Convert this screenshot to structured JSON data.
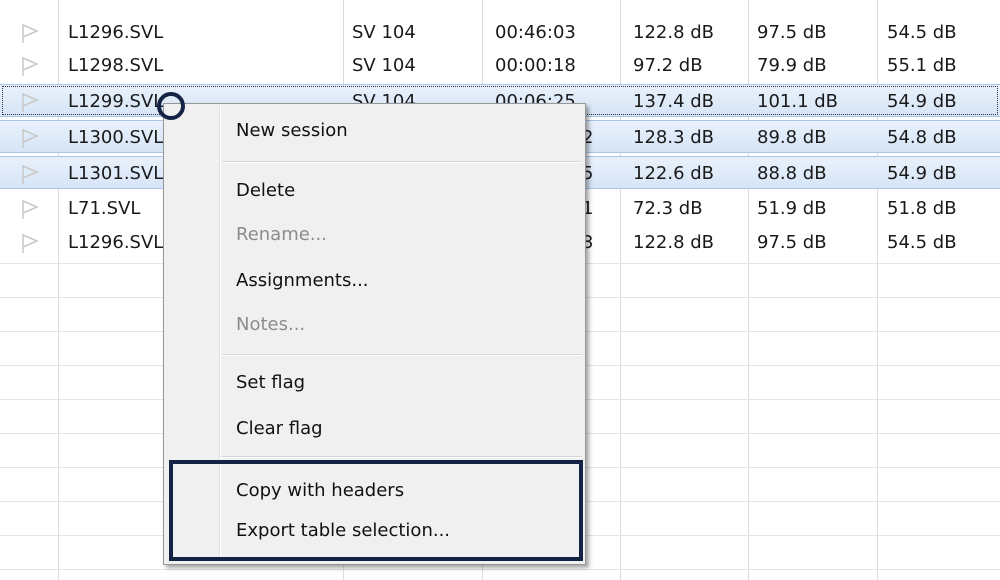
{
  "table": {
    "rows": [
      {
        "file": "L1296.SVL",
        "device": "SV 104",
        "duration": "00:46:03",
        "peak": "122.8 dB",
        "max": "97.5 dB",
        "min": "54.5 dB"
      },
      {
        "file": "L1298.SVL",
        "device": "SV 104",
        "duration": "00:00:18",
        "peak": "97.2 dB",
        "max": "79.9 dB",
        "min": "55.1 dB"
      },
      {
        "file": "L1299.SVL",
        "device": "SV 104",
        "duration": "00:06:25",
        "peak": "137.4 dB",
        "max": "101.1 dB",
        "min": "54.9 dB"
      },
      {
        "file": "L1300.SVL",
        "device": "",
        "duration": "2",
        "peak": "128.3 dB",
        "max": "89.8 dB",
        "min": "54.8 dB"
      },
      {
        "file": "L1301.SVL",
        "device": "",
        "duration": "5",
        "peak": "122.6 dB",
        "max": "88.8 dB",
        "min": "54.9 dB"
      },
      {
        "file": "L71.SVL",
        "device": "",
        "duration": "1",
        "peak": "72.3 dB",
        "max": "51.9 dB",
        "min": "51.8 dB"
      },
      {
        "file": "L1296.SVL",
        "device": "",
        "duration": "3",
        "peak": "122.8 dB",
        "max": "97.5 dB",
        "min": "54.5 dB"
      }
    ]
  },
  "context_menu": {
    "new_session": "New session",
    "delete": "Delete",
    "rename": "Rename...",
    "assignments": "Assignments...",
    "notes": "Notes...",
    "set_flag": "Set flag",
    "clear_flag": "Clear flag",
    "copy_with_headers": "Copy with headers",
    "export_table_selection": "Export table selection..."
  },
  "colors": {
    "selection": "#d6e5f7",
    "annotation": "#142244"
  }
}
